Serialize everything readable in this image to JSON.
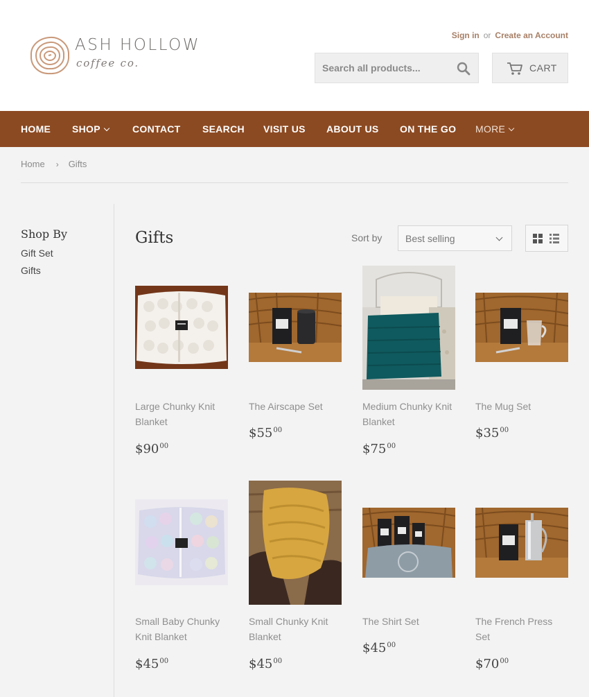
{
  "brand": {
    "name": "ASH HOLLOW",
    "tagline": "coffee co."
  },
  "account": {
    "sign_in": "Sign in",
    "or": "or",
    "create": "Create an Account"
  },
  "search": {
    "placeholder": "Search all products..."
  },
  "cart": {
    "label": "CART"
  },
  "nav": [
    {
      "label": "HOME"
    },
    {
      "label": "SHOP"
    },
    {
      "label": "CONTACT"
    },
    {
      "label": "SEARCH"
    },
    {
      "label": "VISIT US"
    },
    {
      "label": "ABOUT US"
    },
    {
      "label": "ON THE GO"
    },
    {
      "label": "MORE"
    }
  ],
  "breadcrumb": {
    "home": "Home",
    "sep": "›",
    "current": "Gifts"
  },
  "sidebar": {
    "title": "Shop By",
    "links": [
      "Gift Set",
      "Gifts"
    ]
  },
  "collection": {
    "title": "Gifts",
    "sort_label": "Sort by",
    "sort_value": "Best selling"
  },
  "products": [
    {
      "name": "Large Chunky Knit Blanket",
      "price_main": "$90",
      "price_cents": "00"
    },
    {
      "name": "The Airscape Set",
      "price_main": "$55",
      "price_cents": "00"
    },
    {
      "name": "Medium Chunky Knit Blanket",
      "price_main": "$75",
      "price_cents": "00"
    },
    {
      "name": "The Mug Set",
      "price_main": "$35",
      "price_cents": "00"
    },
    {
      "name": "Small Baby Chunky Knit Blanket",
      "price_main": "$45",
      "price_cents": "00"
    },
    {
      "name": "Small Chunky Knit Blanket",
      "price_main": "$45",
      "price_cents": "00"
    },
    {
      "name": "The Shirt Set",
      "price_main": "$45",
      "price_cents": "00"
    },
    {
      "name": "The French Press Set",
      "price_main": "$70",
      "price_cents": "00"
    }
  ],
  "colors": {
    "nav_bg": "#8c4a22",
    "link": "#a77f66",
    "page_bg": "#f3f3f3"
  }
}
